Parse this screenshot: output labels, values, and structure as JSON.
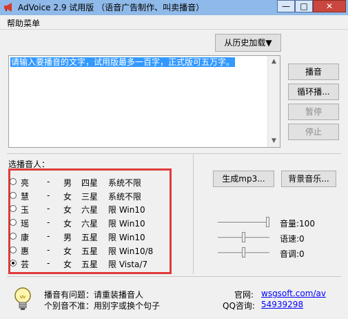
{
  "window": {
    "title": "AdVoice 2.9 试用版 （语音广告制作、叫卖播音）",
    "minimize": "—",
    "maximize": "□",
    "close": "✕"
  },
  "menu": {
    "help": "帮助菜单"
  },
  "history_button": "从历史加载▼",
  "input": {
    "text": "请输入要播音的文字，试用版最多一百字，正式版可五万字。"
  },
  "buttons": {
    "play": "播音",
    "loop": "循环播...",
    "pause": "暂停",
    "stop": "停止",
    "gen_mp3": "生成mp3...",
    "bg_music": "背景音乐..."
  },
  "voice_group_label": "选播音人：",
  "voices": [
    {
      "name": "亮",
      "dash": "-",
      "gender": "男",
      "stars": "四星",
      "req": "系统不限",
      "selected": false
    },
    {
      "name": "慧",
      "dash": "-",
      "gender": "女",
      "stars": "三星",
      "req": "系统不限",
      "selected": false
    },
    {
      "name": "玉",
      "dash": "-",
      "gender": "女",
      "stars": "六星",
      "req": "限 Win10",
      "selected": false
    },
    {
      "name": "瑶",
      "dash": "-",
      "gender": "女",
      "stars": "六星",
      "req": "限 Win10",
      "selected": false
    },
    {
      "name": "康",
      "dash": "-",
      "gender": "男",
      "stars": "五星",
      "req": "限 Win10",
      "selected": false
    },
    {
      "name": "惠",
      "dash": "-",
      "gender": "女",
      "stars": "五星",
      "req": "限 Win10/8",
      "selected": false
    },
    {
      "name": "芸",
      "dash": "-",
      "gender": "女",
      "stars": "五星",
      "req": "限 Vista/7",
      "selected": true
    }
  ],
  "sliders": {
    "volume": {
      "label": "音量:100",
      "value": 1.0
    },
    "speed": {
      "label": "语速:0",
      "value": 0.5
    },
    "pitch": {
      "label": "音调:0",
      "value": 0.5
    }
  },
  "tips": {
    "line1": "播音有问题：请重装播音人",
    "line2": "个别音不准：用别字或换个句子"
  },
  "contact": {
    "site_label": "官网:",
    "site_link": "wsgsoft.com/av",
    "qq_label": "QQ咨询:",
    "qq_link": "54939298"
  }
}
